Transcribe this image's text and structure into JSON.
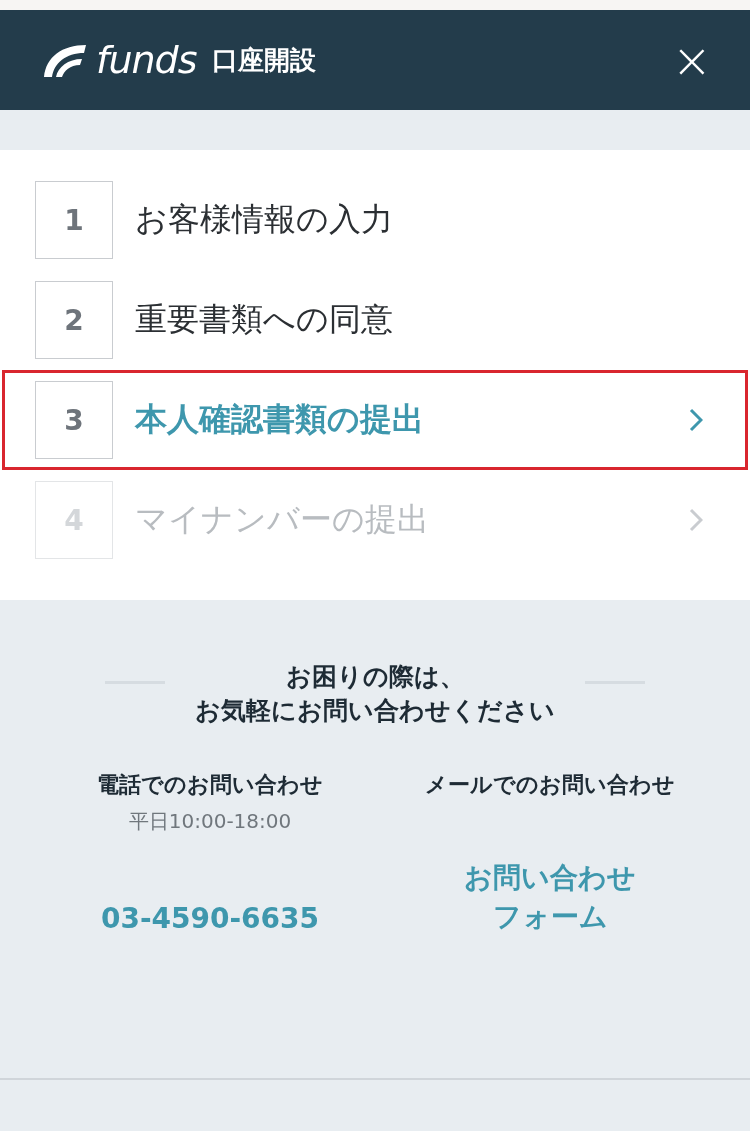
{
  "header": {
    "logo": "funds",
    "title": "口座開設",
    "close": "×"
  },
  "steps": [
    {
      "number": "1",
      "label": "お客様情報の入力",
      "kind": "done",
      "highlighted": false
    },
    {
      "number": "2",
      "label": "重要書類への同意",
      "kind": "done",
      "highlighted": false
    },
    {
      "number": "3",
      "label": "本人確認書類の提出",
      "kind": "current",
      "highlighted": true
    },
    {
      "number": "4",
      "label": "マイナンバーの提出",
      "kind": "locked",
      "highlighted": false
    }
  ],
  "help": {
    "heading": [
      "お困りの際は、",
      "お気軽にお問い合わせください"
    ],
    "phone": {
      "title": "電話でのお問い合わせ",
      "hours": "平日10:00-18:00",
      "link": "03-4590-6635"
    },
    "mail": {
      "title": "メールでのお問い合わせ",
      "link": [
        "お問い合わせ",
        "フォーム"
      ]
    }
  }
}
